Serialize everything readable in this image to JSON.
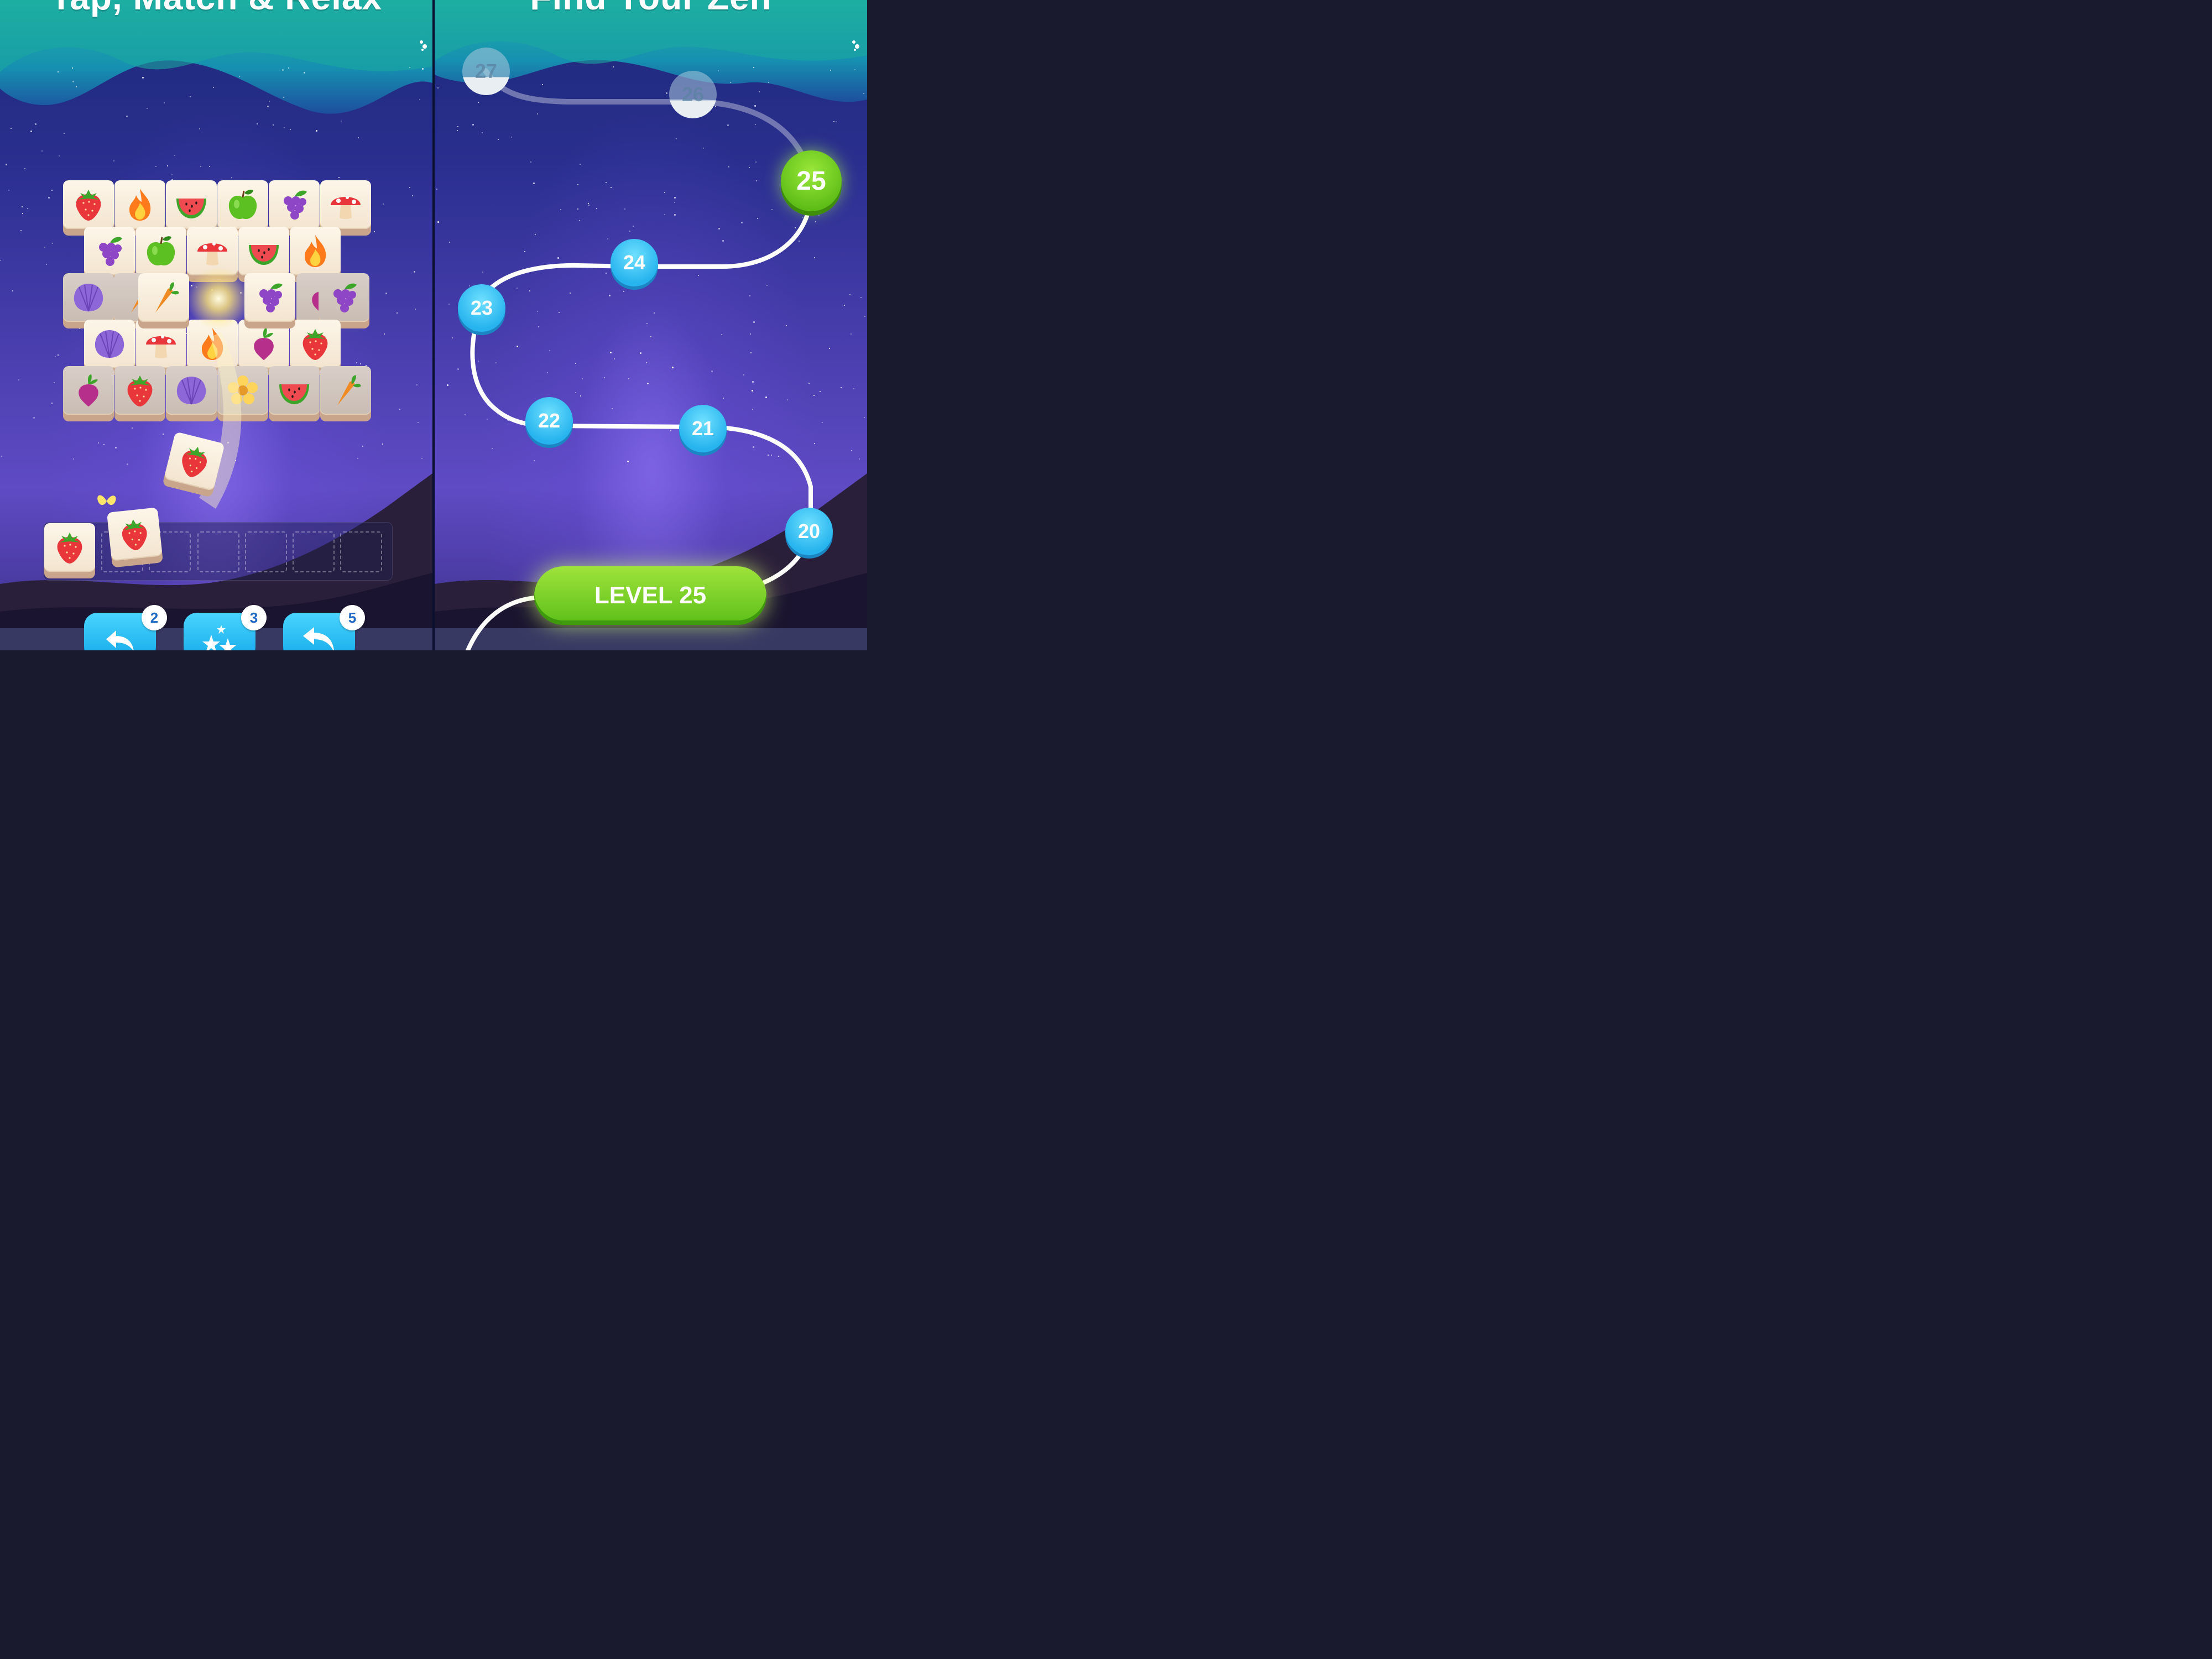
{
  "left_screen": {
    "headline": "Tap, Match & Relax",
    "board": {
      "rows": [
        [
          "strawberry",
          "fire",
          "watermelon",
          "apple",
          "grapes",
          "mushroom"
        ],
        [
          "grapes",
          "apple",
          "mushroom",
          "watermelon",
          "fire"
        ],
        [
          "shell",
          "carrot",
          "carrot",
          "sparkle",
          "grapes",
          "radish",
          "grapes"
        ],
        [
          "shell",
          "mushroom",
          "fire",
          "radish",
          "strawberry"
        ],
        [
          "radish",
          "strawberry",
          "shell",
          "flower",
          "watermelon",
          "carrot"
        ]
      ]
    },
    "tray": {
      "filled": [
        "strawberry",
        "strawberry"
      ],
      "slot_count": 7
    },
    "boosters": [
      {
        "name": "undo",
        "count": "2"
      },
      {
        "name": "shuffle",
        "count": "3"
      },
      {
        "name": "return",
        "count": "5"
      }
    ]
  },
  "right_screen": {
    "headline": "Find Your Zen",
    "levels": [
      {
        "number": "27",
        "state": "locked"
      },
      {
        "number": "26",
        "state": "locked"
      },
      {
        "number": "25",
        "state": "current"
      },
      {
        "number": "24",
        "state": "done"
      },
      {
        "number": "23",
        "state": "done"
      },
      {
        "number": "22",
        "state": "done"
      },
      {
        "number": "21",
        "state": "done"
      },
      {
        "number": "20",
        "state": "done"
      }
    ],
    "play_button": "LEVEL 25"
  },
  "colors": {
    "teal": "#1aa3a8",
    "sky": "#2a2f8f",
    "green": "#6cc31f",
    "blue_node": "#27b4ee"
  }
}
